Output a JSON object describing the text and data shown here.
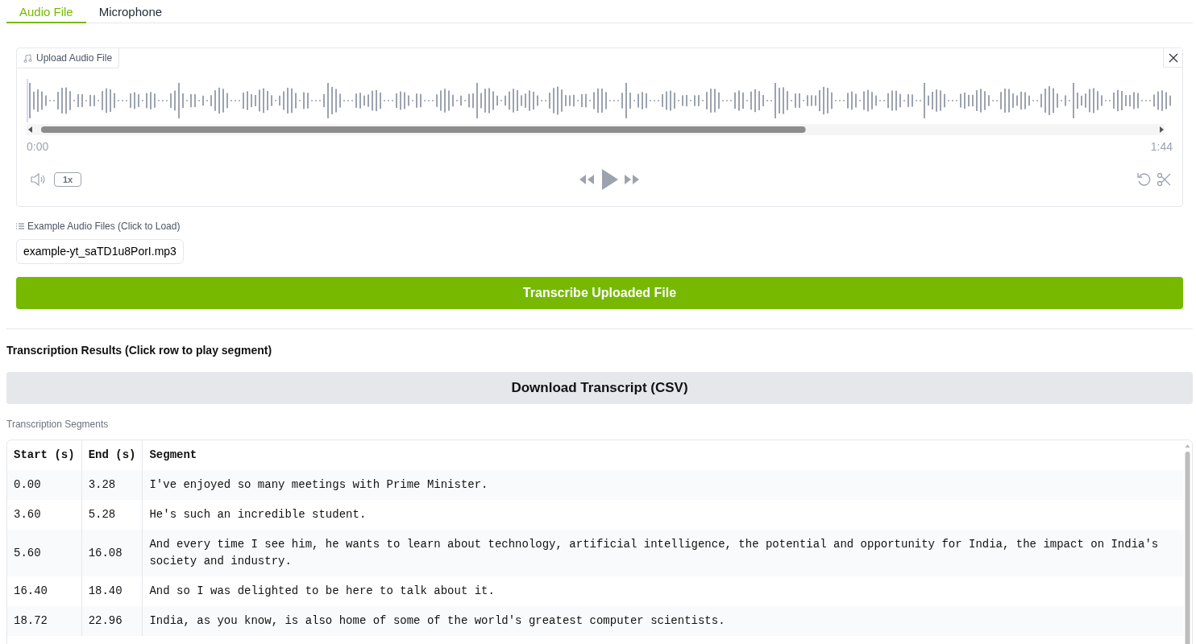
{
  "tabs": [
    {
      "label": "Audio File",
      "selected": true
    },
    {
      "label": "Microphone",
      "selected": false
    }
  ],
  "audio_player": {
    "label": "Upload Audio File",
    "current_time": "0:00",
    "duration": "1:44",
    "speed": "1x"
  },
  "examples": {
    "label": "Example Audio Files (Click to Load)",
    "files": [
      "example-yt_saTD1u8PorI.mp3"
    ]
  },
  "transcribe_button": "Transcribe Uploaded File",
  "results": {
    "heading": "Transcription Results (Click row to play segment)",
    "download_button": "Download Transcript (CSV)",
    "table_label": "Transcription Segments",
    "columns": [
      "Start (s)",
      "End (s)",
      "Segment"
    ],
    "rows": [
      [
        "0.00",
        "3.28",
        "I've enjoyed so many meetings with Prime Minister."
      ],
      [
        "3.60",
        "5.28",
        "He's such an incredible student."
      ],
      [
        "5.60",
        "16.08",
        "And every time I see him, he wants to learn about technology, artificial intelligence, the potential and opportunity for India, the impact on India's society and industry."
      ],
      [
        "16.40",
        "18.40",
        "And so I was delighted to be here to talk about it."
      ],
      [
        "18.72",
        "22.96",
        "India, as you know, is also home of some of the world's greatest computer scientists."
      ]
    ]
  }
}
